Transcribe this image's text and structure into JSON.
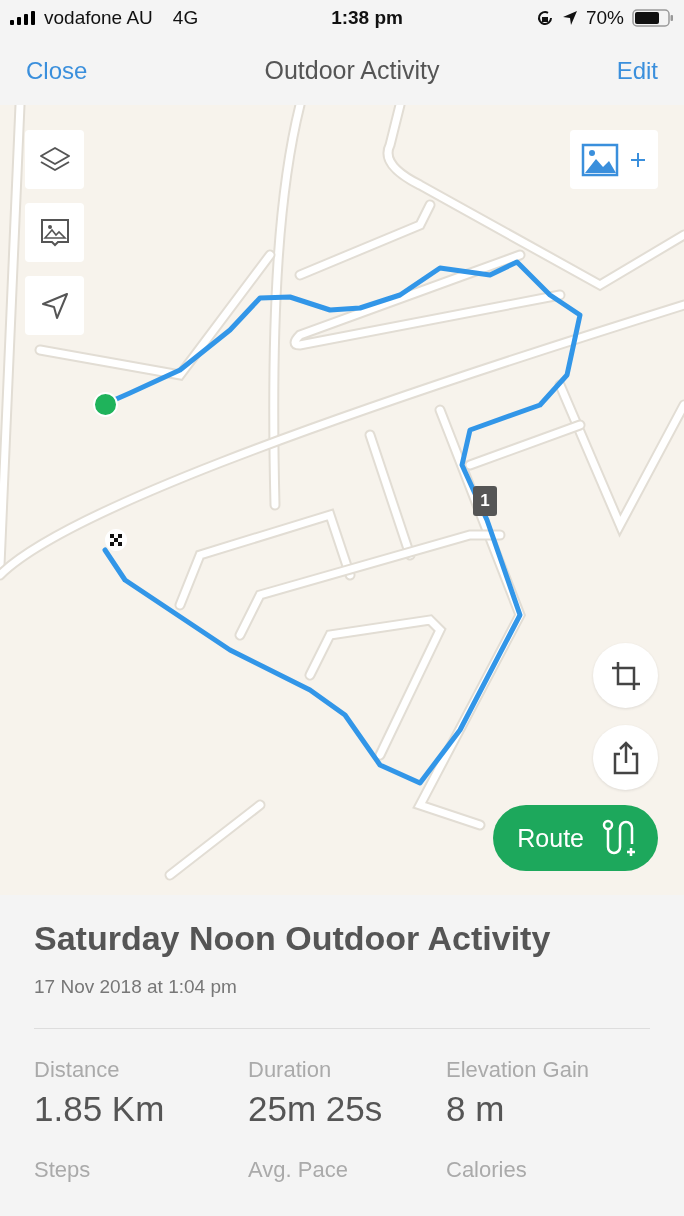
{
  "status_bar": {
    "carrier": "vodafone AU",
    "network": "4G",
    "time": "1:38 pm",
    "battery": "70%"
  },
  "nav": {
    "left": "Close",
    "title": "Outdoor Activity",
    "right": "Edit"
  },
  "map": {
    "km_marker": "1",
    "route_button": "Route"
  },
  "activity": {
    "title": "Saturday Noon Outdoor Activity",
    "date": "17 Nov 2018 at 1:04 pm",
    "stats": [
      {
        "label": "Distance",
        "value": "1.85 Km"
      },
      {
        "label": "Duration",
        "value": "25m 25s"
      },
      {
        "label": "Elevation Gain",
        "value": "8 m"
      },
      {
        "label": "Steps"
      },
      {
        "label": "Avg. Pace"
      },
      {
        "label": "Calories"
      }
    ]
  }
}
